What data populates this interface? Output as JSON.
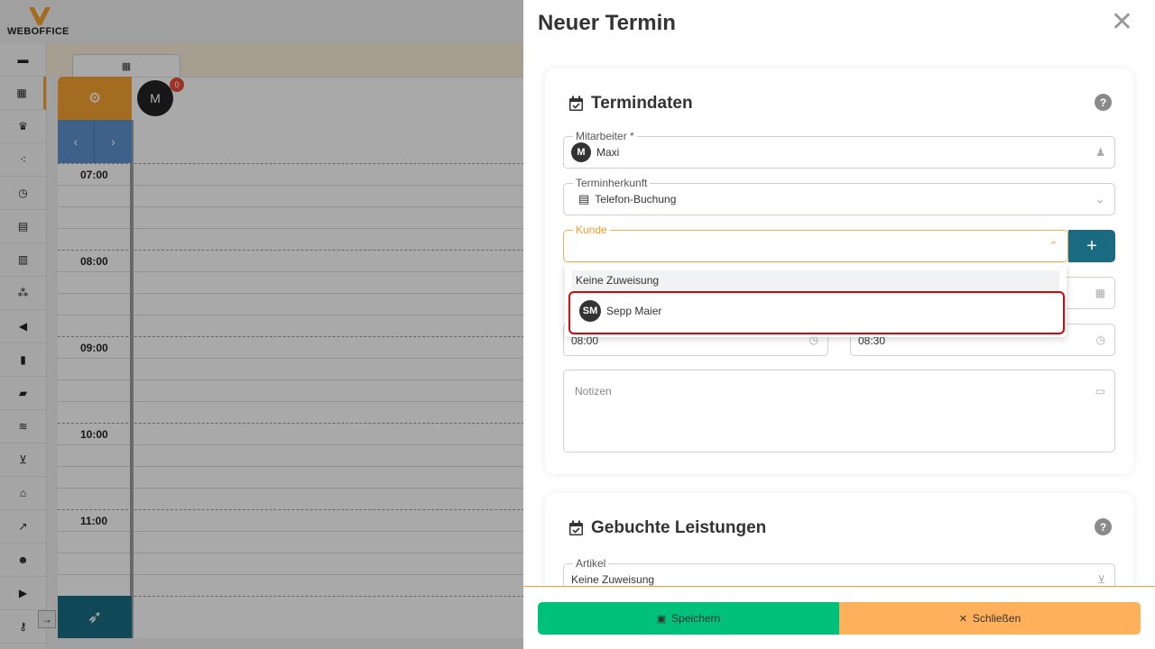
{
  "app": {
    "logo_text": "WEBOFFICE",
    "sidebar_icons": [
      "inbox-icon",
      "calendar-icon",
      "crown-icon",
      "network-icon",
      "clock-icon",
      "document-icon",
      "list-icon",
      "boxes-icon",
      "megaphone-icon",
      "chart-icon",
      "folder-icon",
      "database-icon",
      "cart-icon",
      "warehouse-icon",
      "stats-icon",
      "users-icon",
      "truck-icon",
      "key-icon"
    ],
    "employee_avatar": "M",
    "employee_badge": "0",
    "times": [
      "07:00",
      "08:00",
      "09:00",
      "10:00",
      "11:00"
    ]
  },
  "drawer": {
    "title": "Neuer Termin",
    "section_appointment": {
      "title": "Termindaten",
      "help": "?",
      "employee": {
        "label": "Mitarbeiter *",
        "avatar": "M",
        "value": "Maxi"
      },
      "origin": {
        "label": "Terminherkunft",
        "value": "Telefon-Buchung"
      },
      "customer": {
        "label": "Kunde",
        "value": ""
      },
      "start_time": "08:00",
      "end_time": "08:30",
      "notes": {
        "placeholder": "Notizen"
      }
    },
    "dropdown": {
      "hint": "Keine Zuweisung",
      "option": {
        "initials": "SM",
        "name": "Sepp Maier"
      }
    },
    "section_services": {
      "title": "Gebuchte Leistungen",
      "help": "?",
      "article": {
        "label": "Artikel",
        "value": "Keine Zuweisung"
      }
    },
    "buttons": {
      "save": "Speichern",
      "close": "Schließen"
    }
  }
}
